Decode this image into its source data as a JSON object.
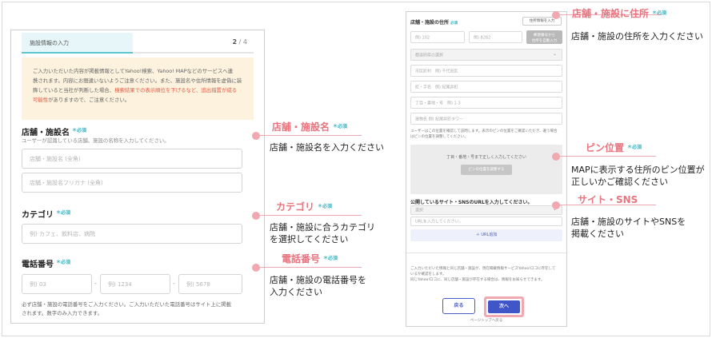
{
  "left_form": {
    "step_title": "施設情報の入力",
    "step_current": "2",
    "step_total": "/ 4",
    "notice_lines": [
      "ご入力いただいた内容が掲載情報としてYahoo!検索、Yahoo! MAPなどのサービスへ連",
      "携されます。内容にお間違いないようご注意ください。また、施設名や住所情報を虚偽に装",
      "飾していると当社が判断した場合、"
    ],
    "notice_red_1": "検索結果での表示順位を下げるなど、追出措置が成る",
    "notice_red_2": "可能性",
    "notice_tail": "がありますので、ご注意ください。",
    "name": {
      "label": "店舗・施設名",
      "required": "＊必須",
      "sub": "ユーザーが認識している店舗、施設の名称を入力してください。",
      "placeholder_1": "店舗・施設名 (全角)",
      "placeholder_2": "店舗・施設名フリガナ (全角)"
    },
    "category": {
      "label": "カテゴリ",
      "required": "＊必須",
      "placeholder": "例) カフェ、飲料店、病院"
    },
    "phone": {
      "label": "電話番号",
      "required": "＊必須",
      "placeholder_1": "例) 03",
      "placeholder_2": "例) 1234",
      "placeholder_3": "例) 5678",
      "sep": "-",
      "footer_1": "必ず店舗・施設の電話番号をご入力ください。ご入力いただいた電話番号はサイト上に掲載",
      "footer_2": "されます。数字のみ入力できます。"
    }
  },
  "callouts": {
    "name": {
      "title": "店舗・施設名",
      "req": "＊必須",
      "desc": "店舗・施設名を入力ください"
    },
    "category": {
      "title": "カテゴリ",
      "req": "＊必須",
      "desc_1": "店舗・施設に合うカテゴリ",
      "desc_2": "を選択してください"
    },
    "phone": {
      "title": "電話番号",
      "req": "＊必須",
      "desc_1": "店舗・施設の電話番号を",
      "desc_2": "入力ください"
    },
    "address": {
      "title": "店舗・施設に住所",
      "req": "＊必須",
      "desc": "店舗・施設の住所を入力ください"
    },
    "pin": {
      "title": "ピン位置",
      "req": "＊必須",
      "desc_1": "MAPに表示する住所のピン位置が",
      "desc_2": "正しいかご確認ください"
    },
    "site": {
      "title": "サイト・SNS",
      "desc_1": "店舗・施設のサイトやSNSを",
      "desc_2": "掲載ください"
    }
  },
  "right_form": {
    "address_title": "店舗・施設の住所",
    "address_req": "必須",
    "btn_no_address": "住所情報を入力",
    "zip_1": "例) 102",
    "zip_2": "例) 8282",
    "btn_zip_1": "郵便番号から",
    "btn_zip_2": "住所を自動入力",
    "pref": "都道府県の選択",
    "city": "市区町村　例) 千代田区",
    "town": "町・字名　例) 紀尾井町",
    "chome": "丁目・番地・号　例) 1-3",
    "building": "建物名 例) 紀尾井町タワー",
    "note_1": "ユーザーはこの位置を確認して訪問します。表示のピンの位置をご確認いただき、違う場合",
    "note_2": "はピンの位置を調整してください。",
    "map_text": "丁目・番地・号まで正しく入力してください",
    "map_btn": "ピンの位置を調整する",
    "site_title": "公開しているサイト・SNSのURLを入力してください。",
    "site_select": "選択",
    "url_placeholder": "URLを入力してください。",
    "add_url": "＋ URL追加",
    "bottom_1": "ご入力いただいた情報と同じ店舗・施設が、現在掲載情報サービスYahoo!ロコに存在して",
    "bottom_2": "いるか確認をします。",
    "bottom_3": "同じYahoo!ロコに、同じ店舗・施設が存在する場合は、情報をお知らせできます。",
    "back": "戻る",
    "next": "次へ",
    "totop": "ページトップへ戻る"
  },
  "colors": {
    "accent": "#e8747f",
    "required": "#3bb3c3",
    "primary": "#3f55c8"
  }
}
